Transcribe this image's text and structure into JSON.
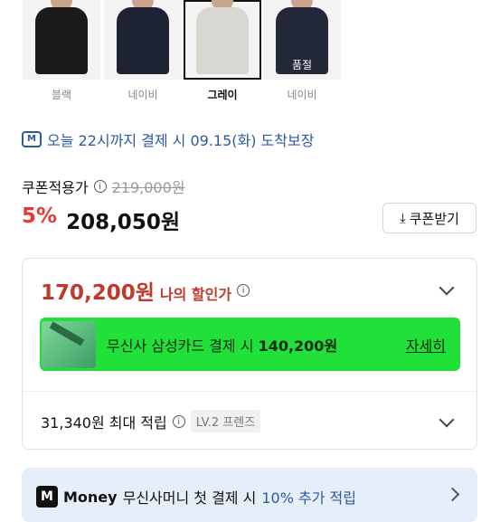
{
  "swatches": [
    {
      "label": "블랙",
      "color": "#1a1a1a",
      "selected": false
    },
    {
      "label": "네이비",
      "color": "#1e2333",
      "selected": false
    },
    {
      "label": "그레이",
      "color": "#d9d7d2",
      "selected": true
    },
    {
      "label": "네이비",
      "color": "#24293a",
      "selected": false,
      "badge": "품절"
    }
  ],
  "delivery": {
    "icon": "delivery-truck-icon",
    "text": "오늘 22시까지 결제 시 09.15(화) 도착보장"
  },
  "price": {
    "coupon_label": "쿠폰적용가",
    "original": "219,000원",
    "discount": "5%",
    "final": "208,050원"
  },
  "coupon_button": {
    "label": "쿠폰받기"
  },
  "benefit": {
    "amount": "170,200원",
    "label": "나의 할인가"
  },
  "promo": {
    "text_prefix": "무신사 삼성카드 결제 시",
    "text_amount": "140,200원",
    "detail_label": "자세히",
    "color": "#22e03a"
  },
  "points": {
    "text": "31,340원 최대 적립",
    "level": "LV.2 프렌즈"
  },
  "money": {
    "logo": "M",
    "brand": "Money",
    "text": "무신사머니 첫 결제 시",
    "highlight": "10% 추가 적립"
  }
}
